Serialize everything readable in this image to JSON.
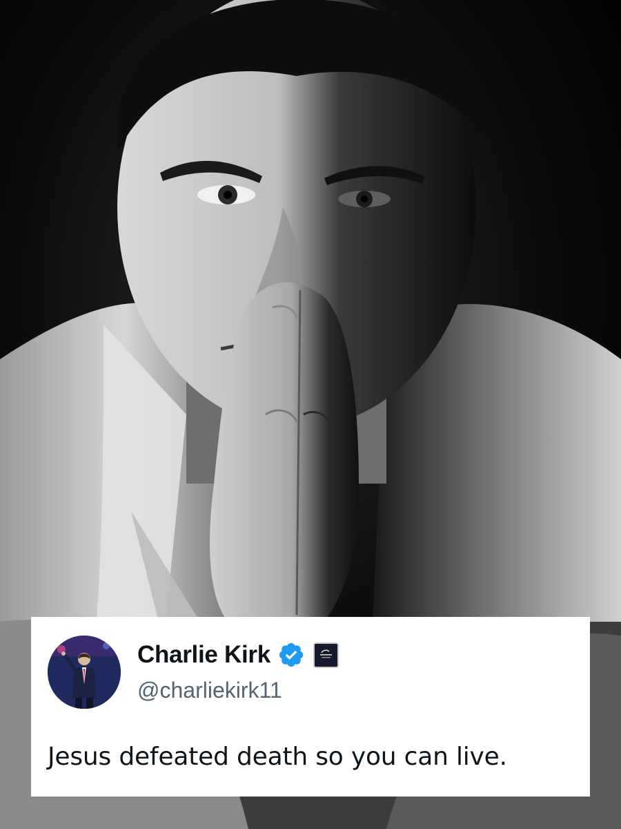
{
  "photo": {
    "subject": "portrait-photo"
  },
  "tweet": {
    "display_name": "Charlie Kirk",
    "handle": "@charliekirk11",
    "text": "Jesus defeated death so you can live.",
    "verified_icon": "verified-badge-icon",
    "affiliate_icon": "organization-affiliate-badge-icon",
    "colors": {
      "verified_blue": "#1d9bf0",
      "name": "#0f1419",
      "handle": "#536471",
      "card_background": "#ffffff"
    }
  }
}
